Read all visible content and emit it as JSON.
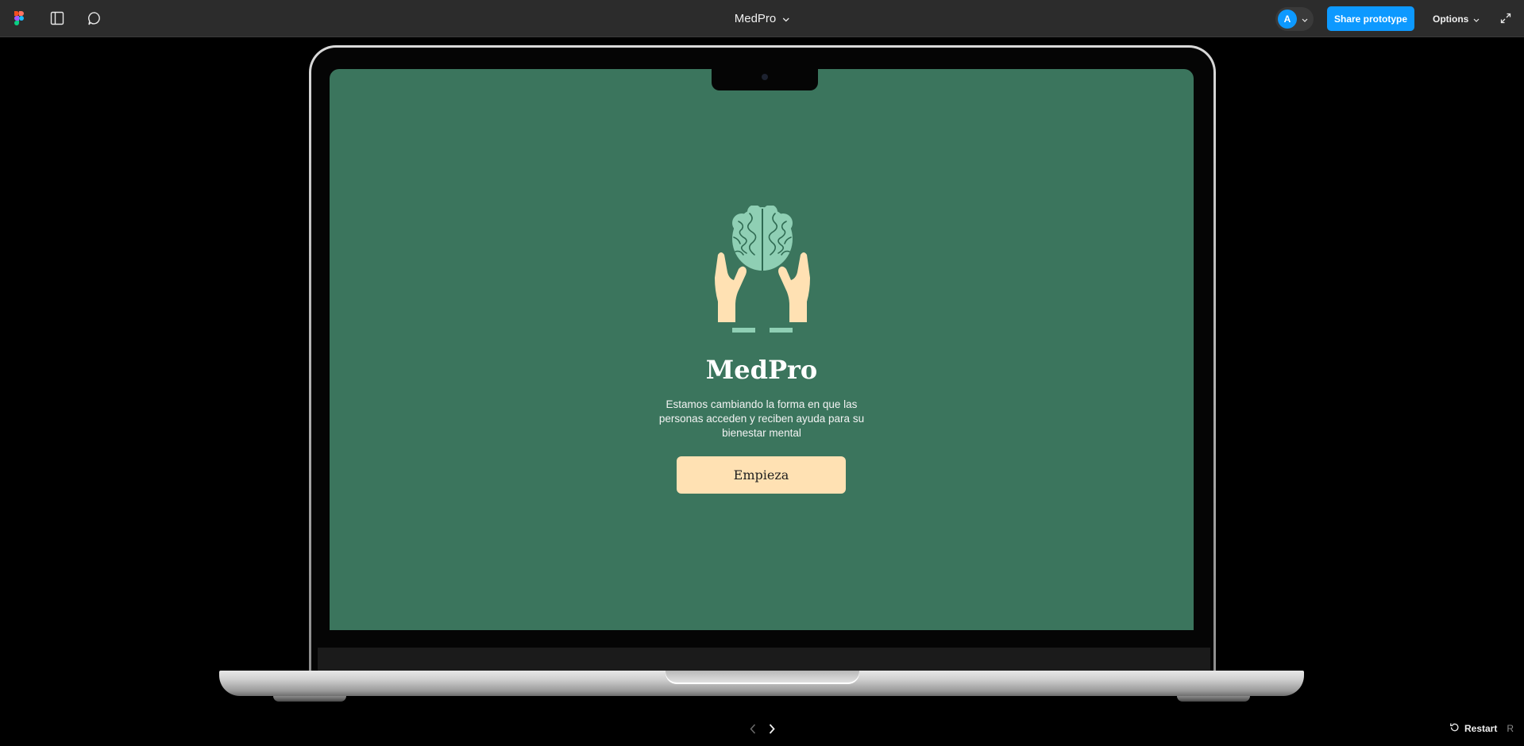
{
  "toolbar": {
    "doc_title": "MedPro",
    "avatar_initial": "A",
    "share_label": "Share prototype",
    "options_label": "Options",
    "icons": [
      "figma-logo-icon",
      "sidebar-toggle-icon",
      "comment-icon",
      "chevron-down-icon",
      "expand-icon"
    ]
  },
  "screen": {
    "app_title": "MedPro",
    "subtitle": "Estamos cambiando la forma en que las personas acceden y reciben ayuda para su bienestar mental",
    "cta_label": "Empieza",
    "background_color": "#3b755d",
    "cta_color": "#ffe1b3",
    "logo_icon": "brain-in-hands-icon"
  },
  "footer": {
    "restart_label": "Restart",
    "restart_shortcut": "R",
    "icons": [
      "prev-arrow-icon",
      "next-arrow-icon",
      "restart-icon"
    ]
  },
  "colors": {
    "accent": "#0d99ff",
    "toolbar_bg": "#2c2c2c"
  }
}
